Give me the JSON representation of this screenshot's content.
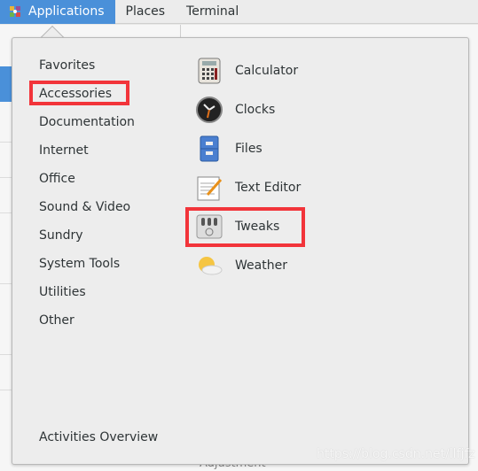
{
  "topbar": {
    "items": [
      {
        "label": "Applications",
        "active": true
      },
      {
        "label": "Places"
      },
      {
        "label": "Terminal"
      }
    ]
  },
  "menu": {
    "categories": [
      "Favorites",
      "Accessories",
      "Documentation",
      "Internet",
      "Office",
      "Sound & Video",
      "Sundry",
      "System Tools",
      "Utilities",
      "Other"
    ],
    "selected_category": "Accessories",
    "apps": [
      {
        "label": "Calculator",
        "icon": "calculator-icon"
      },
      {
        "label": "Clocks",
        "icon": "clock-icon"
      },
      {
        "label": "Files",
        "icon": "file-cabinet-icon"
      },
      {
        "label": "Text Editor",
        "icon": "text-editor-icon"
      },
      {
        "label": "Tweaks",
        "icon": "tweaks-icon"
      },
      {
        "label": "Weather",
        "icon": "weather-icon"
      }
    ],
    "activities_overview": "Activities Overview"
  },
  "background": {
    "partial_label": "Adjustment"
  },
  "watermark": "https://blog.csdn.net/llfjfz",
  "colors": {
    "accent": "#4a90d9",
    "highlight_box": "#f2343a"
  }
}
